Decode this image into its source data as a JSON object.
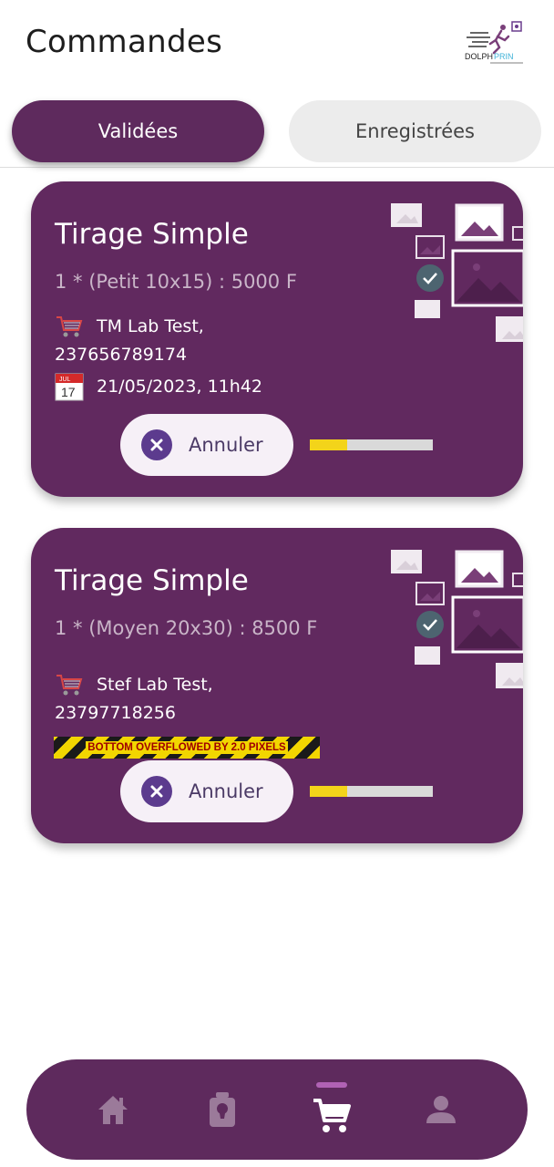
{
  "header": {
    "title": "Commandes",
    "logo_icon": "dolph-print-logo",
    "logo_text": "DOLPH PRINT"
  },
  "tabs": [
    {
      "label": "Validées",
      "active": true
    },
    {
      "label": "Enregistrées",
      "active": false
    }
  ],
  "orders": [
    {
      "title": "Tirage Simple",
      "detail": "1 * (Petit 10x15) : 5000 F",
      "customer": "TM Lab Test,",
      "phone": "237656789174",
      "date": "21/05/2023, 11h42",
      "cancel_label": "Annuler",
      "progress": 0.3
    },
    {
      "title": "Tirage Simple",
      "detail": "1 * (Moyen 20x30) : 8500 F",
      "customer": "Stef Lab Test,",
      "phone": "23797718256",
      "cancel_label": "Annuler",
      "progress": 0.3,
      "overflow_warning": "BOTTOM OVERFLOWED BY 2.0 PIXELS"
    }
  ],
  "calendar_icon": {
    "month": "JUL",
    "day": "17"
  },
  "bottom_nav": {
    "items": [
      {
        "icon": "home-icon",
        "active": false
      },
      {
        "icon": "photo-order-icon",
        "active": false
      },
      {
        "icon": "cart-icon",
        "active": true
      },
      {
        "icon": "profile-icon",
        "active": false
      }
    ]
  },
  "colors": {
    "primary": "#61295f",
    "accent": "#f3d41a",
    "nav_inactive": "#9b7a9a",
    "nav_active": "#ffffff"
  }
}
